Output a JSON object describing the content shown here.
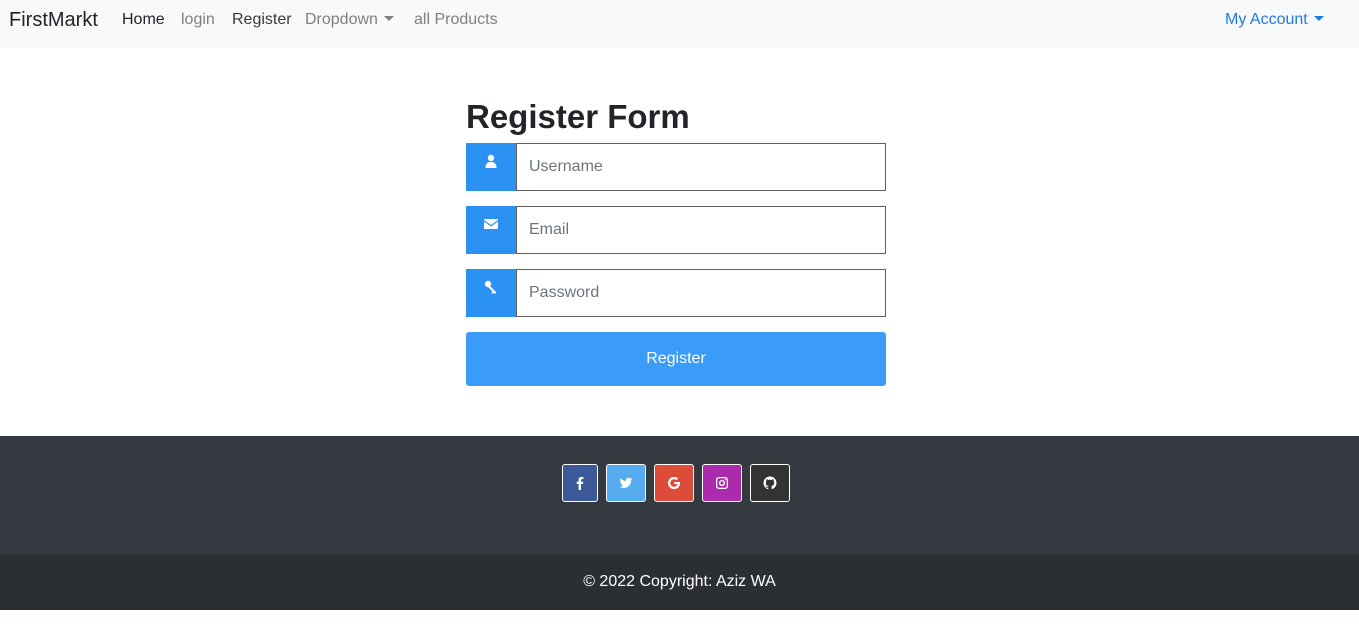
{
  "navbar": {
    "brand": "FirstMarkt",
    "links": [
      {
        "label": "Home"
      },
      {
        "label": "login"
      },
      {
        "label": "Register"
      },
      {
        "label": "Dropdown"
      },
      {
        "label": "all Products"
      }
    ],
    "account_label": "My Account"
  },
  "form": {
    "title": "Register Form",
    "username_placeholder": "Username",
    "email_placeholder": "Email",
    "password_placeholder": "Password",
    "submit_label": "Register"
  },
  "footer": {
    "social": [
      {
        "name": "facebook",
        "color": "#3b5998"
      },
      {
        "name": "twitter",
        "color": "#55acee"
      },
      {
        "name": "google",
        "color": "#dd4b39"
      },
      {
        "name": "instagram",
        "color": "#ac2bac"
      },
      {
        "name": "github",
        "color": "#333333"
      }
    ],
    "copyright": "© 2022 Copyright: Aziz WA"
  },
  "colors": {
    "accent": "#2b92f3",
    "button": "#3a9bf9",
    "footer_top": "#343a40",
    "footer_bottom": "#2b2f33"
  }
}
